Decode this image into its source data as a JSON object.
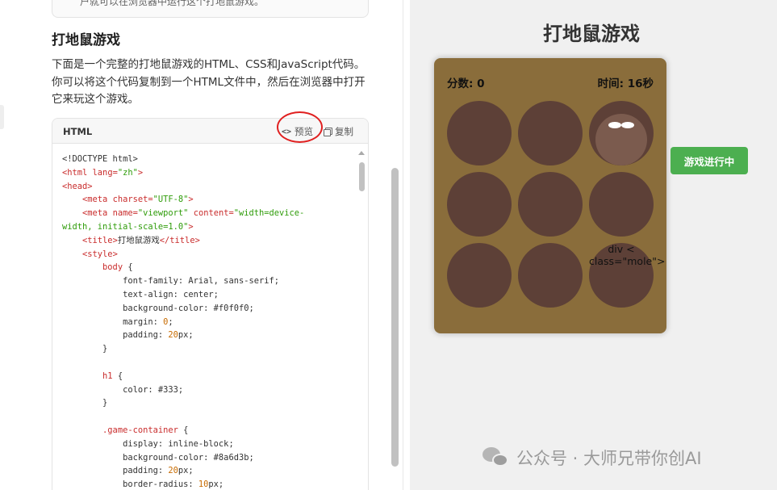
{
  "left": {
    "previous_card_text": "户就可以在浏览器中运行这个打地鼠游戏。",
    "section_heading": "打地鼠游戏",
    "section_paragraph": "下面是一个完整的打地鼠游戏的HTML、CSS和JavaScript代码。你可以将这个代码复制到一个HTML文件中，然后在浏览器中打开它来玩这个游戏。",
    "code_block": {
      "language": "HTML",
      "preview_label": "预览",
      "copy_label": "复制",
      "preview_icon": "code-brackets-icon",
      "copy_icon": "copy-icon"
    }
  },
  "game": {
    "title": "打地鼠游戏",
    "score_text": "分数: 0",
    "time_text": "时间: 16秒",
    "status_button": "游戏进行中",
    "leaked_text": "div <\nclass=\"mole\">",
    "active_hole": 3
  },
  "watermark": "公众号 · 大师兄带你创AI",
  "colors": {
    "game_container": "#8a6d3b",
    "hole": "#5d4037",
    "mole": "#7b5b4e",
    "status_button": "#4caf50",
    "annotation": "#e02020"
  }
}
